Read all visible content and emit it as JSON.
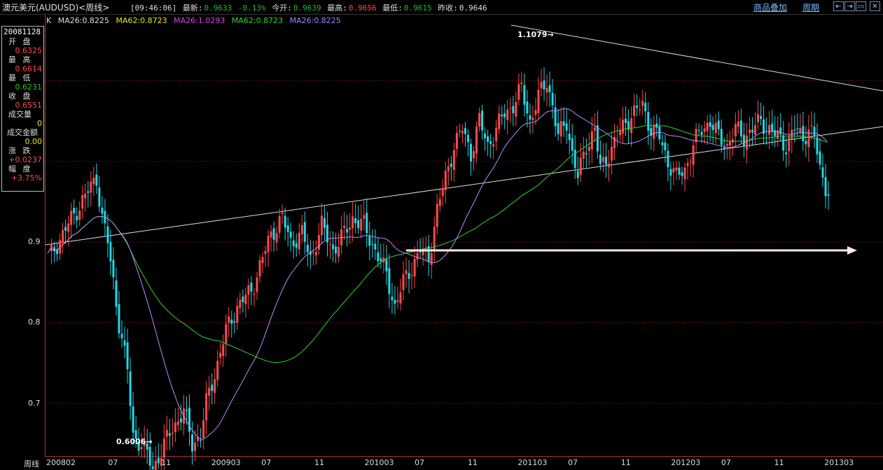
{
  "header": {
    "title": "澳元美元(AUDUSD)<周线>",
    "time": "[09:46:06]",
    "latest_label": "最新:",
    "latest": "0.9633",
    "change": "-0.13%",
    "open_label": "今开:",
    "open": "0.9639",
    "high_label": "最高:",
    "high": "0.9656",
    "low_label": "最低:",
    "low": "0.9615",
    "prev_label": "昨收:",
    "prev": "0.9646",
    "overlay_link": "商品叠加",
    "period_link": "周期"
  },
  "legend": {
    "k": "K",
    "ma1": "MA26:0.8225",
    "ma2": "MA62:0.8723",
    "ma3": "MA26:1.0293",
    "ma4": "MA62:0.8723",
    "ma5": "MA26:0.8225"
  },
  "infobox": {
    "date": "20081128",
    "open_label": "开 盘",
    "open": "0.6325",
    "high_label": "最 高",
    "high": "0.6614",
    "low_label": "最 低",
    "low": "0.6231",
    "close_label": "收 盘",
    "close": "0.6551",
    "volume_label": "成交量",
    "volume": "0",
    "amount_label": "成交金额",
    "amount": "0.00",
    "change_label": "涨 跌",
    "change": "+0.0237",
    "range_label": "幅 度",
    "range": "+3.75%"
  },
  "colors": {
    "up": "#ff4b4b",
    "down": "#22d8e8",
    "ma26": "#b58cff",
    "ma62": "#2ed62e",
    "grid": "#8a1b1b",
    "trend": "#dddddd",
    "arrow": "#ffe8e8"
  },
  "x_axis": {
    "name": "周线",
    "ticks": [
      {
        "label": "200802",
        "x": 0
      },
      {
        "label": "07",
        "x": 21
      },
      {
        "label": "11",
        "x": 39
      },
      {
        "label": "200903",
        "x": 56
      },
      {
        "label": "07",
        "x": 73
      },
      {
        "label": "11",
        "x": 91
      },
      {
        "label": "201003",
        "x": 108
      },
      {
        "label": "07",
        "x": 125
      },
      {
        "label": "11",
        "x": 143
      },
      {
        "label": "201103",
        "x": 160
      },
      {
        "label": "07",
        "x": 177
      },
      {
        "label": "11",
        "x": 195
      },
      {
        "label": "201203",
        "x": 212
      },
      {
        "label": "07",
        "x": 229
      },
      {
        "label": "11",
        "x": 247
      },
      {
        "label": "201303",
        "x": 264
      }
    ]
  },
  "chart_data": {
    "type": "candlestick",
    "y_ticks": [
      0.7,
      0.8,
      0.9
    ],
    "ylim": [
      0.59,
      1.14
    ],
    "annotations": [
      {
        "label": "1.1079",
        "x": 178,
        "y": 1.1079
      },
      {
        "label": "0.6006",
        "x": 39,
        "y": 0.6006
      }
    ],
    "anchors": [
      [
        0,
        0.88
      ],
      [
        5,
        0.91
      ],
      [
        10,
        0.94
      ],
      [
        17,
        0.98
      ],
      [
        19,
        0.93
      ],
      [
        21,
        0.9
      ],
      [
        23,
        0.85
      ],
      [
        25,
        0.8
      ],
      [
        28,
        0.74
      ],
      [
        30,
        0.66
      ],
      [
        33,
        0.65
      ],
      [
        37,
        0.62
      ],
      [
        40,
        0.64
      ],
      [
        44,
        0.67
      ],
      [
        48,
        0.69
      ],
      [
        51,
        0.65
      ],
      [
        54,
        0.66
      ],
      [
        56,
        0.7
      ],
      [
        60,
        0.75
      ],
      [
        63,
        0.79
      ],
      [
        67,
        0.82
      ],
      [
        72,
        0.84
      ],
      [
        76,
        0.88
      ],
      [
        79,
        0.91
      ],
      [
        83,
        0.93
      ],
      [
        86,
        0.9
      ],
      [
        90,
        0.91
      ],
      [
        93,
        0.88
      ],
      [
        97,
        0.92
      ],
      [
        101,
        0.89
      ],
      [
        105,
        0.91
      ],
      [
        108,
        0.93
      ],
      [
        112,
        0.92
      ],
      [
        116,
        0.89
      ],
      [
        120,
        0.86
      ],
      [
        123,
        0.82
      ],
      [
        126,
        0.85
      ],
      [
        129,
        0.87
      ],
      [
        132,
        0.89
      ],
      [
        135,
        0.88
      ],
      [
        138,
        0.94
      ],
      [
        141,
        0.98
      ],
      [
        144,
        1.02
      ],
      [
        147,
        1.04
      ],
      [
        150,
        1.01
      ],
      [
        153,
        1.05
      ],
      [
        156,
        1.02
      ],
      [
        159,
        1.04
      ],
      [
        162,
        1.06
      ],
      [
        165,
        1.07
      ],
      [
        168,
        1.09
      ],
      [
        171,
        1.05
      ],
      [
        174,
        1.08
      ],
      [
        177,
        1.1
      ],
      [
        179,
        1.07
      ],
      [
        181,
        1.03
      ],
      [
        184,
        1.05
      ],
      [
        186,
        1.01
      ],
      [
        188,
        0.98
      ],
      [
        191,
        1.02
      ],
      [
        194,
        1.04
      ],
      [
        196,
        0.99
      ],
      [
        199,
        1.01
      ],
      [
        202,
        1.03
      ],
      [
        205,
        1.05
      ],
      [
        208,
        1.06
      ],
      [
        211,
        1.07
      ],
      [
        214,
        1.04
      ],
      [
        217,
        1.03
      ],
      [
        220,
        1.0
      ],
      [
        223,
        0.98
      ],
      [
        226,
        0.99
      ],
      [
        229,
        1.02
      ],
      [
        232,
        1.04
      ],
      [
        235,
        1.05
      ],
      [
        238,
        1.03
      ],
      [
        241,
        1.02
      ],
      [
        244,
        1.04
      ],
      [
        247,
        1.03
      ],
      [
        250,
        1.04
      ],
      [
        253,
        1.05
      ],
      [
        256,
        1.04
      ],
      [
        259,
        1.03
      ],
      [
        262,
        1.02
      ],
      [
        265,
        1.04
      ],
      [
        268,
        1.03
      ],
      [
        270,
        1.04
      ],
      [
        272,
        1.03
      ],
      [
        274,
        0.99
      ],
      [
        276,
        0.97
      ],
      [
        277,
        0.963
      ]
    ]
  }
}
